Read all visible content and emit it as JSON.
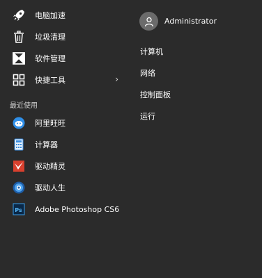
{
  "user": {
    "name": "Administrator"
  },
  "places": [
    {
      "label": "电脑加速",
      "icon": "rocket-icon"
    },
    {
      "label": "垃圾清理",
      "icon": "trash-icon"
    },
    {
      "label": "软件管理",
      "icon": "software-icon"
    },
    {
      "label": "快捷工具",
      "icon": "grid-icon",
      "arrow": "›"
    }
  ],
  "recent": {
    "title": "最近使用",
    "items": [
      {
        "label": "阿里旺旺",
        "icon": "aliwangwang-icon",
        "color": "#2f8fe8"
      },
      {
        "label": "计算器",
        "icon": "calculator-icon",
        "color": "#3b8de0"
      },
      {
        "label": "驱动精灵",
        "icon": "driver-genius-icon",
        "color": "#d8402e"
      },
      {
        "label": "驱动人生",
        "icon": "driver-life-icon",
        "color": "#2f7fd0"
      },
      {
        "label": "Adobe Photoshop CS6",
        "icon": "photoshop-icon",
        "color": "#0a2847"
      }
    ]
  },
  "right_links": [
    "计算机",
    "网络",
    "控制面板",
    "运行"
  ]
}
